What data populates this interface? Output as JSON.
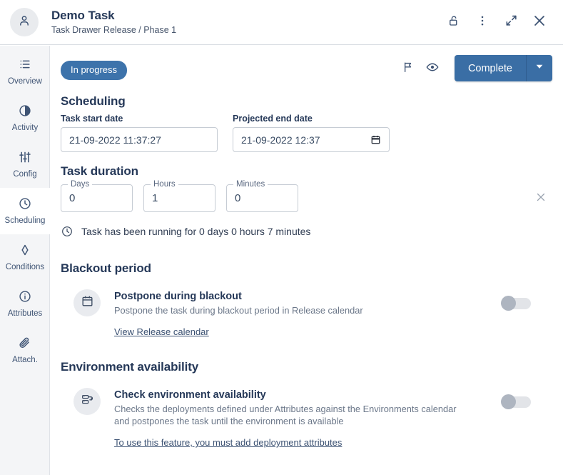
{
  "header": {
    "avatar_icon": "person-icon",
    "title": "Demo Task",
    "subtitle": "Task Drawer Release / Phase 1",
    "actions": [
      {
        "icon": "unlock-icon",
        "name": "lock-toggle"
      },
      {
        "icon": "more-vertical-icon",
        "name": "more-menu"
      },
      {
        "icon": "expand-icon",
        "name": "expand-drawer"
      },
      {
        "icon": "close-icon",
        "name": "close-drawer"
      }
    ]
  },
  "sidebar": {
    "items": [
      {
        "label": "Overview",
        "icon": "list-icon",
        "active": false
      },
      {
        "label": "Activity",
        "icon": "pie-clock-icon",
        "active": false
      },
      {
        "label": "Config",
        "icon": "sliders-icon",
        "active": false
      },
      {
        "label": "Scheduling",
        "icon": "clock-icon",
        "active": true
      },
      {
        "label": "Conditions",
        "icon": "diamond-icon",
        "active": false
      },
      {
        "label": "Attributes",
        "icon": "info-icon",
        "active": false
      },
      {
        "label": "Attach.",
        "icon": "paperclip-icon",
        "active": false
      }
    ]
  },
  "toolbar": {
    "status_badge": "In progress",
    "flag_icon": "flag-icon",
    "watch_icon": "eye-icon",
    "complete_label": "Complete",
    "complete_caret_icon": "chevron-down-icon"
  },
  "scheduling": {
    "heading": "Scheduling",
    "start": {
      "label": "Task start date",
      "value": "21-09-2022 11:37:27"
    },
    "end": {
      "label": "Projected end date",
      "value": "21-09-2022 12:37",
      "picker_icon": "calendar-icon"
    }
  },
  "duration": {
    "heading": "Task duration",
    "fields": [
      {
        "label": "Days",
        "value": "0"
      },
      {
        "label": "Hours",
        "value": "1"
      },
      {
        "label": "Minutes",
        "value": "0"
      }
    ],
    "clear_icon": "close-icon",
    "running_icon": "clock-icon",
    "running_text": "Task has been running for 0 days 0 hours 7 minutes"
  },
  "blackout": {
    "heading": "Blackout period",
    "icon": "calendar-icon",
    "title": "Postpone during blackout",
    "description": "Postpone the task during blackout period in Release calendar",
    "link": "View Release calendar",
    "toggle_on": false
  },
  "environment": {
    "heading": "Environment availability",
    "icon": "server-icon",
    "title": "Check environment availability",
    "description": "Checks the deployments defined under Attributes against the Environments calendar and postpones the task until the environment is available",
    "link": "To use this feature, you must add deployment attributes",
    "toggle_on": false
  },
  "colors": {
    "accent": "#3a6ea5",
    "badge": "#3d73ab",
    "heading": "#253858",
    "sidebar_bg": "#f4f5f7",
    "muted": "#6b7789"
  }
}
